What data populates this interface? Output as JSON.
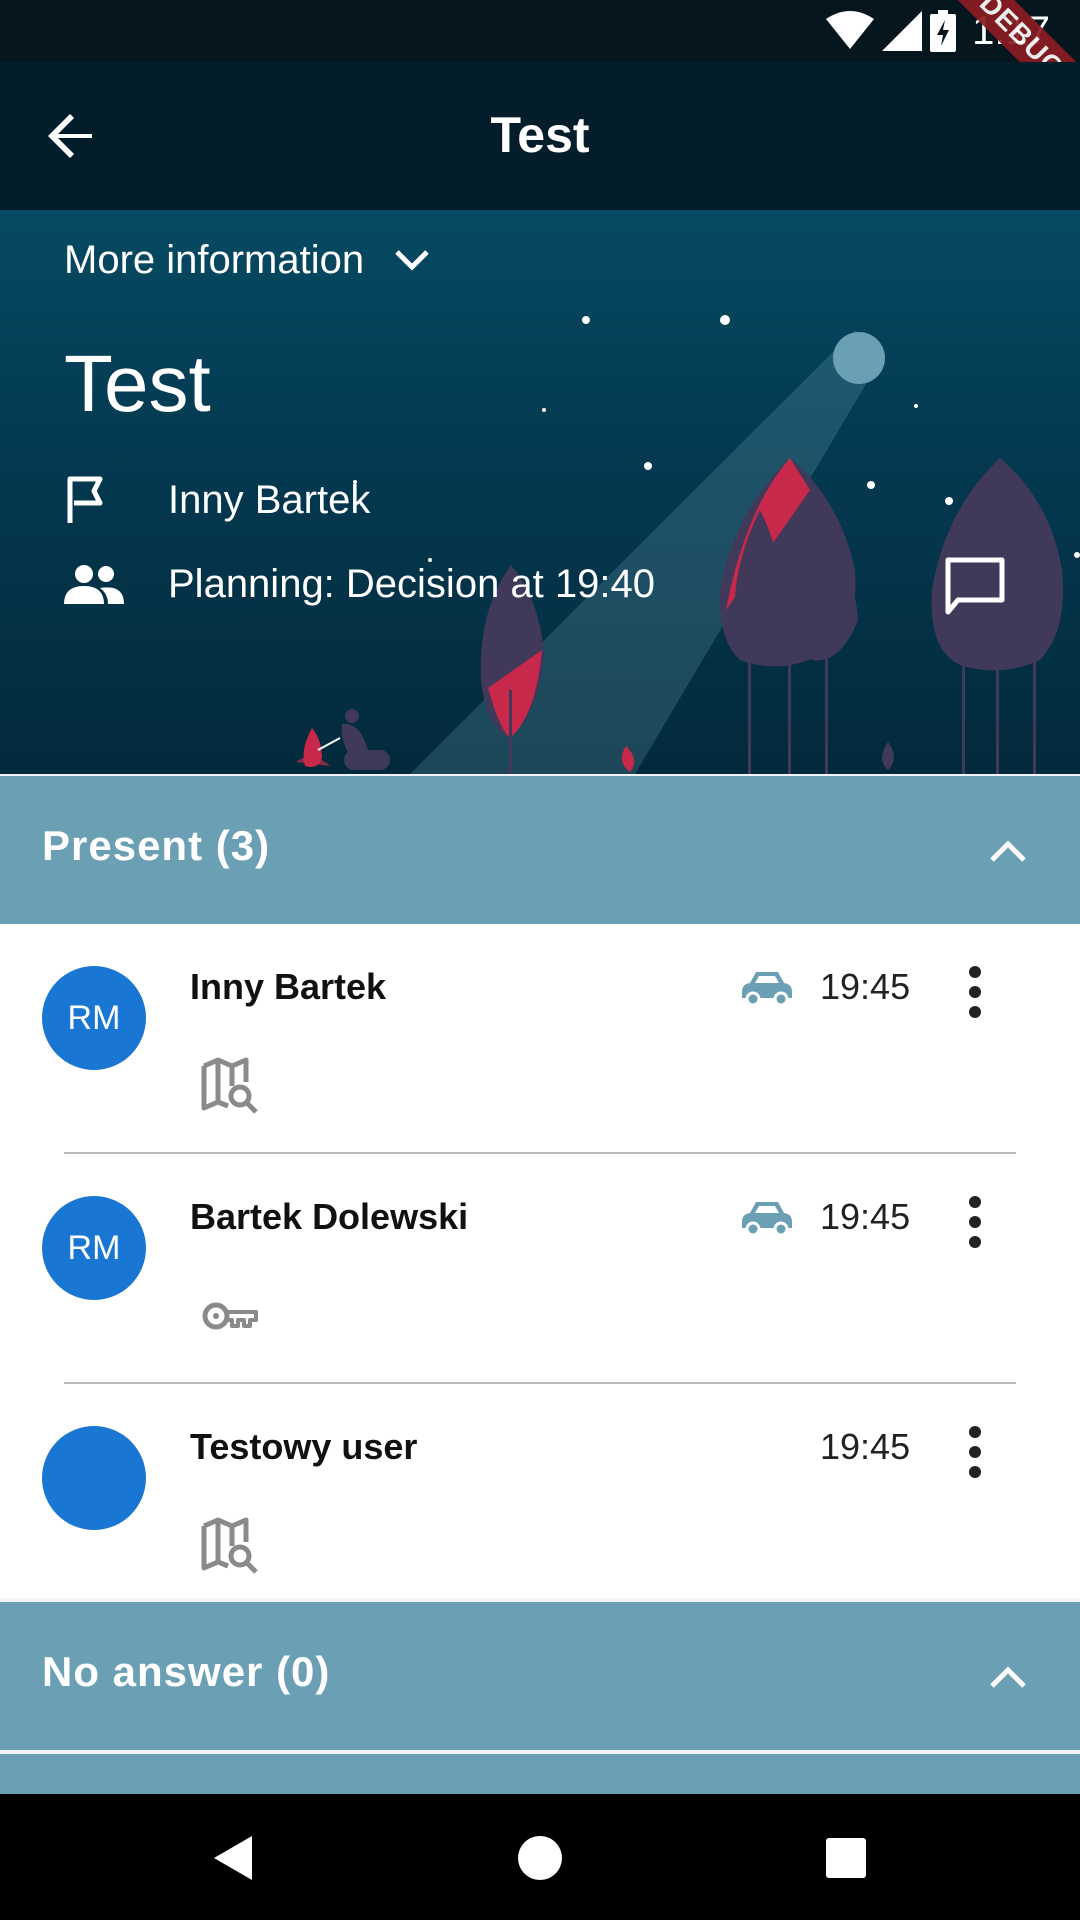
{
  "status_bar": {
    "time": "1:17",
    "debug_label": "DEBUG"
  },
  "app_bar": {
    "title": "Test",
    "back_icon": "arrow-back-icon"
  },
  "hero": {
    "more_info_label": "More information",
    "title": "Test",
    "organizer": "Inny Bartek",
    "status": "Planning: Decision at 19:40"
  },
  "present": {
    "header": "Present (3)",
    "members": [
      {
        "initials": "RM",
        "name": "Inny Bartek",
        "time": "19:45",
        "car": true,
        "detail_icon": "map-search-icon"
      },
      {
        "initials": "RM",
        "name": "Bartek Dolewski",
        "time": "19:45",
        "car": true,
        "detail_icon": "key-icon"
      },
      {
        "initials": "",
        "name": "Testowy user",
        "time": "19:45",
        "car": false,
        "detail_icon": "map-search-icon"
      }
    ]
  },
  "no_answer": {
    "header": "No answer (0)"
  },
  "colors": {
    "app_bar": "#031d2b",
    "section_header": "#6b9fb3",
    "avatar": "#1976d2",
    "accent_red": "#c8294a"
  }
}
